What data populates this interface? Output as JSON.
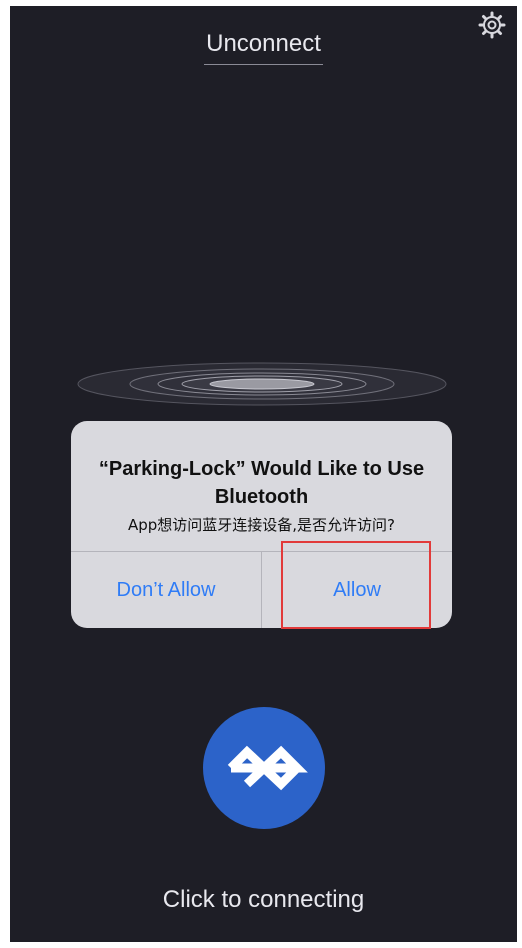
{
  "header": {
    "title": "Unconnect",
    "settings_icon": "gear-icon"
  },
  "scanner": {
    "icon": "radar-rings-icon"
  },
  "dialog": {
    "title": "“Parking-Lock” Would Like to Use Bluetooth",
    "message": "App想访问蓝牙连接设备,是否允许访问?",
    "deny_label": "Don’t Allow",
    "allow_label": "Allow"
  },
  "connect": {
    "icon": "bluetooth-icon",
    "status": "Click to connecting"
  },
  "colors": {
    "background": "#1e1e26",
    "accent_blue": "#2c63c9",
    "dialog_button_text": "#2f7cf6",
    "highlight": "#e23a3a"
  }
}
